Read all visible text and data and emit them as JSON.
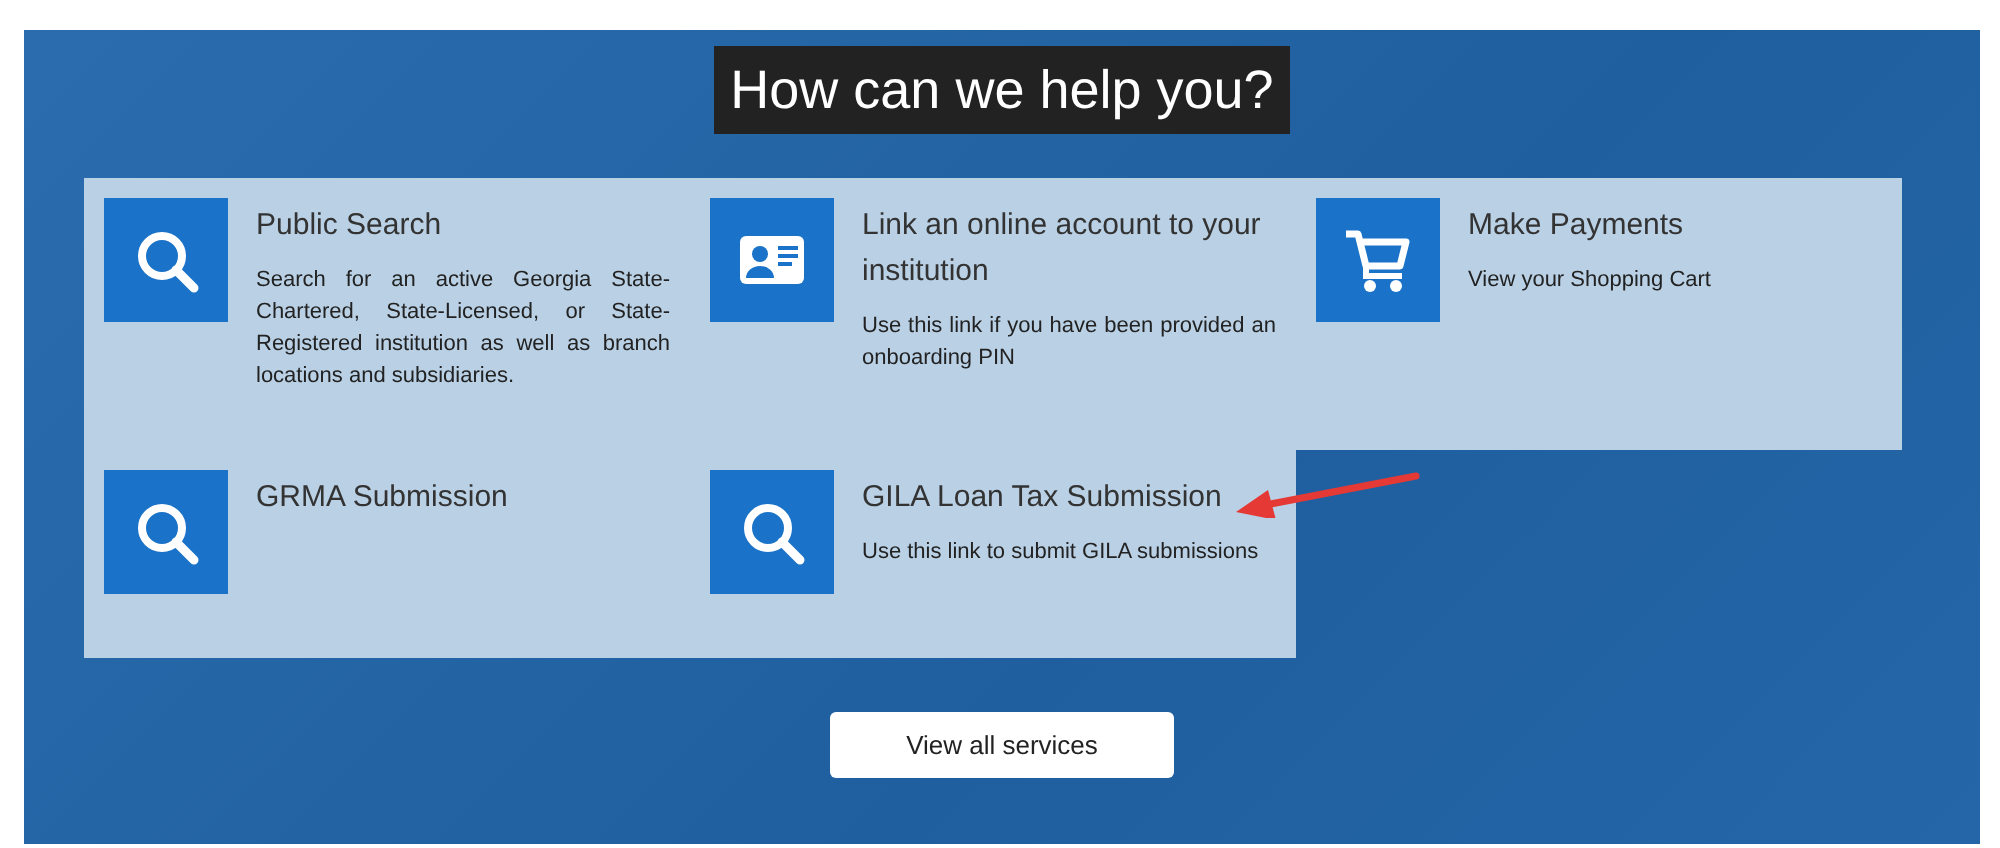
{
  "heading": "How can we help you?",
  "services": [
    {
      "kind": "search",
      "title": "Public Search",
      "description": "Search for an active Georgia State-Chartered, State-Licensed, or State-Registered institution as well as branch locations and subsidiaries."
    },
    {
      "kind": "id-card",
      "title": "Link an online account to your institution",
      "description": "Use this link if you have been provided an onboarding PIN"
    },
    {
      "kind": "cart",
      "title": "Make Payments",
      "description": "View your Shopping Cart"
    },
    {
      "kind": "search",
      "title": "GRMA Submission"
    },
    {
      "kind": "search",
      "title": "GILA Loan Tax Submission",
      "description": "Use this link to submit GILA submissions"
    }
  ],
  "button": "View all services"
}
